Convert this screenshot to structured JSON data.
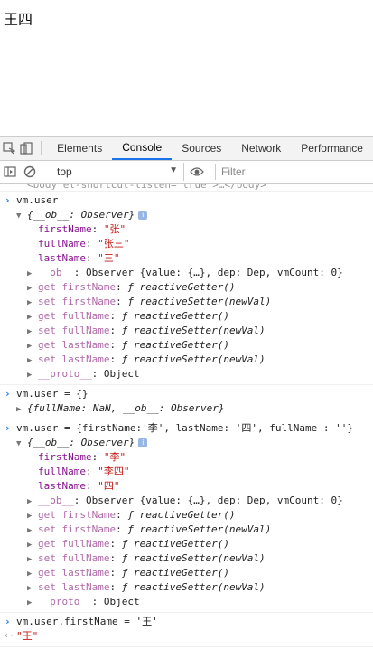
{
  "page": {
    "content_text": "王四"
  },
  "devtools": {
    "tabs": [
      "Elements",
      "Console",
      "Sources",
      "Network",
      "Performance"
    ],
    "active_tab": "Console",
    "context_select": "top",
    "filter_placeholder": "Filter"
  },
  "console": {
    "cut_line": "<body el-shortcut-listen=\"true\">…</body>",
    "entry1": {
      "input": "vm.user",
      "header": "{__ob__: Observer}",
      "p1_key": "firstName",
      "p1_val": "\"张\"",
      "p2_key": "fullName",
      "p2_val": "\"张三\"",
      "p3_key": "lastName",
      "p3_val": "\"三\"",
      "ob_key": "__ob__",
      "ob_val": "Observer {value: {…}, dep: Dep, vmCount: 0}",
      "g1_key": "get firstName",
      "g1_val": "ƒ reactiveGetter()",
      "s1_key": "set firstName",
      "s1_val": "ƒ reactiveSetter(newVal)",
      "g2_key": "get fullName",
      "g2_val": "ƒ reactiveGetter()",
      "s2_key": "set fullName",
      "s2_val": "ƒ reactiveSetter(newVal)",
      "g3_key": "get lastName",
      "g3_val": "ƒ reactiveGetter()",
      "s3_key": "set lastName",
      "s3_val": "ƒ reactiveSetter(newVal)",
      "proto_key": "__proto__",
      "proto_val": "Object"
    },
    "entry2": {
      "input": "vm.user = {}",
      "result": "{fullName: NaN, __ob__: Observer}"
    },
    "entry3": {
      "input": "vm.user = {firstName:'李', lastName: '四', fullName : ''}",
      "header": "{__ob__: Observer}",
      "p1_key": "firstName",
      "p1_val": "\"李\"",
      "p2_key": "fullName",
      "p2_val": "\"李四\"",
      "p3_key": "lastName",
      "p3_val": "\"四\"",
      "ob_key": "__ob__",
      "ob_val": "Observer {value: {…}, dep: Dep, vmCount: 0}",
      "g1_key": "get firstName",
      "g1_val": "ƒ reactiveGetter()",
      "s1_key": "set firstName",
      "s1_val": "ƒ reactiveSetter(newVal)",
      "g2_key": "get fullName",
      "g2_val": "ƒ reactiveGetter()",
      "s2_key": "set fullName",
      "s2_val": "ƒ reactiveSetter(newVal)",
      "g3_key": "get lastName",
      "g3_val": "ƒ reactiveGetter()",
      "s3_key": "set lastName",
      "s3_val": "ƒ reactiveSetter(newVal)",
      "proto_key": "__proto__",
      "proto_val": "Object"
    },
    "entry4": {
      "input": "vm.user.firstName = '王'",
      "result": "\"王\""
    }
  }
}
